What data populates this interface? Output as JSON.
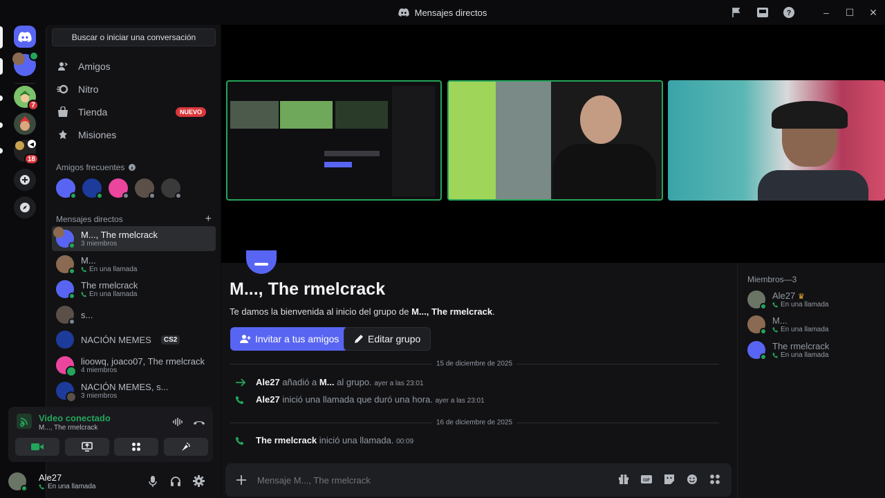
{
  "window": {
    "title": "Mensajes directos"
  },
  "sidebar": {
    "search_label": "Buscar o iniciar una conversación",
    "nav": [
      {
        "label": "Amigos"
      },
      {
        "label": "Nitro"
      },
      {
        "label": "Tienda",
        "badge": "NUEVO"
      },
      {
        "label": "Misiones"
      }
    ],
    "frequent_header": "Amigos frecuentes",
    "dm_header": "Mensajes directos",
    "dms": [
      {
        "name": "M..., The rmelcrack",
        "sub": "3 miembros"
      },
      {
        "name": "M...",
        "sub": "En una llamada"
      },
      {
        "name": "The rmelcrack",
        "sub": "En una llamada"
      },
      {
        "name": "s...",
        "sub": ""
      },
      {
        "name": "NACIÓN MEMES",
        "tag": "CS2"
      },
      {
        "name": "lioowq, joaco07, The rmelcrack",
        "sub": "4 miembros"
      },
      {
        "name": "NACIÓN MEMES, s...",
        "sub": "3 miembros"
      }
    ]
  },
  "servers": {
    "badges": [
      "7",
      "18"
    ]
  },
  "voice": {
    "status": "Video conectado",
    "channel": "M..., The rmelcrack"
  },
  "user": {
    "name": "Ale27",
    "status": "En una llamada"
  },
  "group": {
    "title": "M..., The rmelcrack",
    "welcome_prefix": "Te damos la bienvenida al inicio del grupo de ",
    "welcome_name": "M..., The rmelcrack",
    "welcome_suffix": ".",
    "invite_label": "Invitar a tus amigos",
    "edit_label": "Editar grupo"
  },
  "messages": {
    "date1": "15 de diciembre de 2025",
    "m1_user": "Ale27",
    "m1_text_a": "añadió a",
    "m1_target": "M...",
    "m1_text_b": "al grupo.",
    "m1_time": "ayer a las 23:01",
    "m2_user": "Ale27",
    "m2_text": "inició una llamada que duró una hora.",
    "m2_time": "ayer a las 23:01",
    "date2": "16 de diciembre de 2025",
    "m3_user": "The rmelcrack",
    "m3_text": "inició una llamada.",
    "m3_time": "00:09"
  },
  "composer": {
    "placeholder": "Mensaje M..., The rmelcrack"
  },
  "members": {
    "header": "Miembros—3",
    "list": [
      {
        "name": "Ale27",
        "status": "En una llamada"
      },
      {
        "name": "M...",
        "status": "En una llamada"
      },
      {
        "name": "The rmelcrack",
        "status": "En una llamada"
      }
    ]
  },
  "colors": {
    "blurple": "#5865f2",
    "green": "#23a55a",
    "red": "#da373c"
  }
}
